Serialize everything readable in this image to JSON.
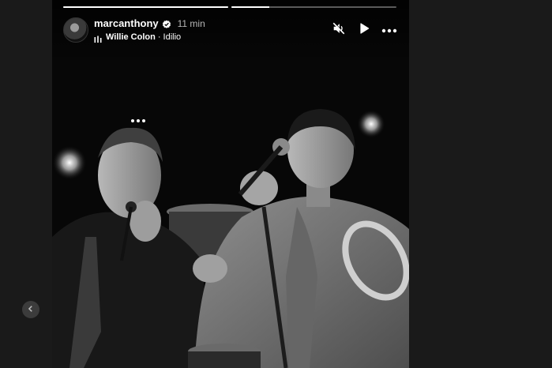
{
  "story": {
    "username": "marcanthony",
    "time_ago": "11 min",
    "music": {
      "artist": "Willie Colon",
      "separator": "·",
      "song": "Idilio"
    },
    "progress": [
      1.0,
      0.23
    ],
    "verified": true
  },
  "icons": {
    "mute": "speaker-muted-icon",
    "play": "play-icon",
    "more": "more-horizontal-icon",
    "music": "music-bars-icon",
    "verified": "verified-badge-icon",
    "prev": "chevron-left-icon"
  },
  "colors": {
    "background": "#1a1a1a",
    "viewer": "#050505",
    "text": "#ffffff",
    "verified": "#ffffff"
  }
}
